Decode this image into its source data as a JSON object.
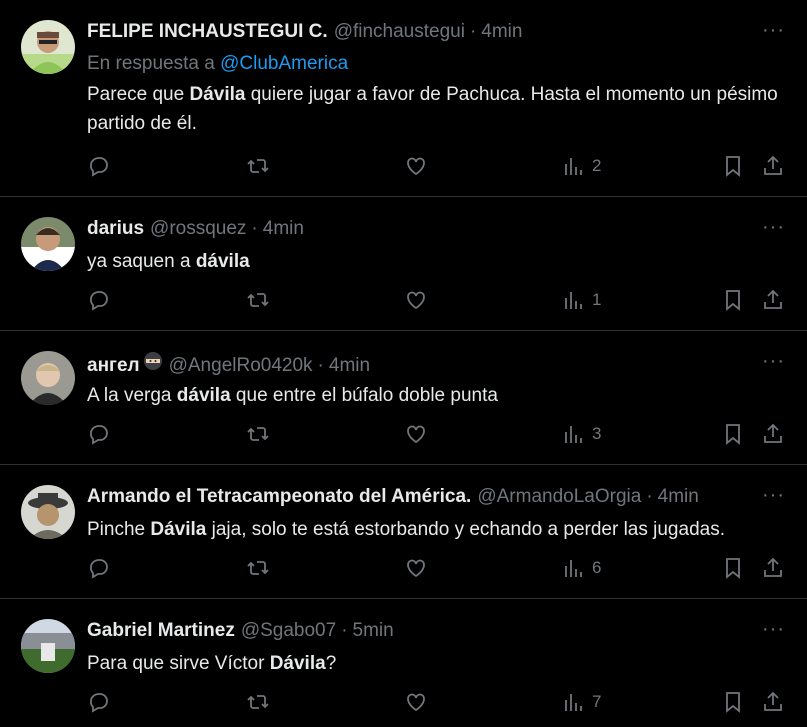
{
  "tweets": [
    {
      "name": "FELIPE INCHAUSTEGUI C.",
      "handle": "@finchaustegui",
      "time": "4min",
      "reply_prefix": "En respuesta a",
      "reply_to": "@ClubAmerica",
      "text_parts": [
        "Parece que ",
        "Dávila",
        " quiere jugar a favor de Pachuca. Hasta el momento un pésimo partido de él."
      ],
      "views": "2",
      "avatar": "avatar-felipe"
    },
    {
      "name": "darius",
      "handle": "@rossquez",
      "time": "4min",
      "text_parts": [
        "ya saquen a ",
        "dávila",
        ""
      ],
      "views": "1",
      "avatar": "avatar-darius"
    },
    {
      "name": "ангел",
      "handle": "@AngelRo0420k",
      "time": "4min",
      "name_emoji": "ninja",
      "text_parts": [
        "A la verga ",
        "dávila",
        " que entre el búfalo doble punta"
      ],
      "views": "3",
      "avatar": "avatar-angel"
    },
    {
      "name": "Armando el Tetracampeonato del América.",
      "handle": "@ArmandoLaOrgia",
      "time": "4min",
      "text_parts": [
        "Pinche ",
        "Dávila",
        " jaja, solo te está estorbando y echando a perder las jugadas."
      ],
      "views": "6",
      "avatar": "avatar-armando"
    },
    {
      "name": "Gabriel Martinez",
      "handle": "@Sgabo07",
      "time": "5min",
      "text_parts": [
        "Para que sirve Víctor ",
        "Dávila",
        "?"
      ],
      "views": "7",
      "avatar": "avatar-gabriel"
    }
  ],
  "separator": "·",
  "more_glyph": "···",
  "icons": [
    "reply-icon",
    "retweet-icon",
    "like-icon",
    "views-icon",
    "bookmark-icon",
    "share-icon"
  ],
  "colors": {
    "background": "#000000",
    "text": "#e7e9ea",
    "muted": "#71767b",
    "link": "#1d9bf0",
    "divider": "#2f3336"
  }
}
